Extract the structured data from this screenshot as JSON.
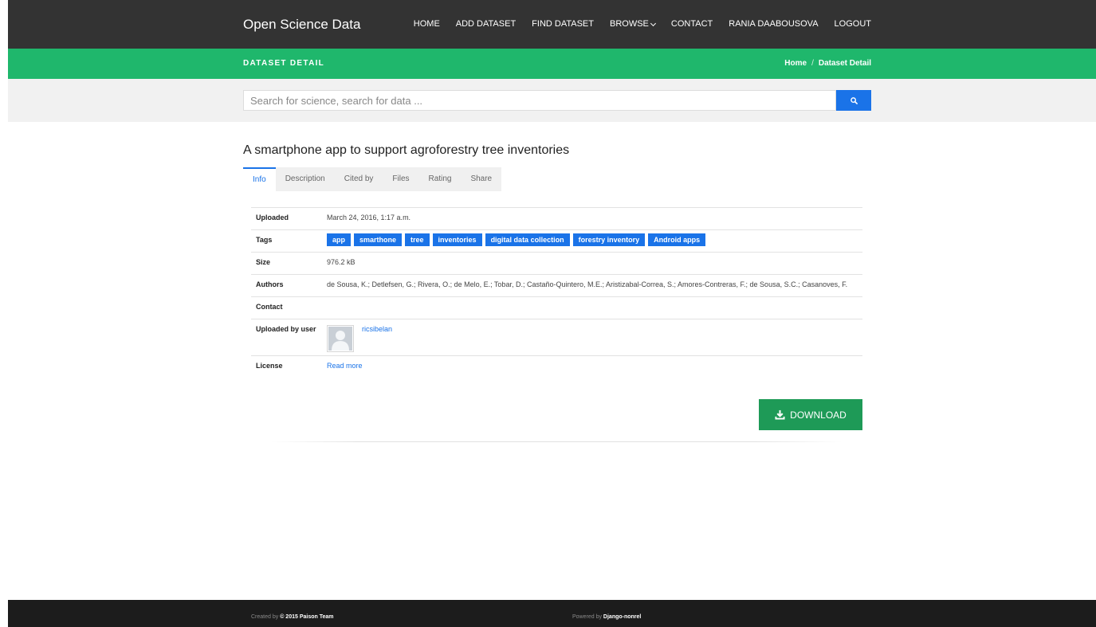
{
  "header": {
    "brand": "Open Science Data",
    "nav": [
      "HOME",
      "ADD DATASET",
      "FIND DATASET",
      "BROWSE",
      "CONTACT",
      "RANIA DAABOUSOVA",
      "LOGOUT"
    ]
  },
  "titlebar": {
    "title": "DATASET DETAIL",
    "breadcrumb": [
      "Home",
      "/",
      "Dataset Detail"
    ]
  },
  "search": {
    "placeholder": "Search for science, search for data ..."
  },
  "dataset": {
    "title": "A smartphone app to support agroforestry tree inventories",
    "tabs": [
      "Info",
      "Description",
      "Cited by",
      "Files",
      "Rating",
      "Share"
    ],
    "rows": {
      "uploaded_label": "Uploaded",
      "uploaded_value": "March 24, 2016, 1:17 a.m.",
      "tags_label": "Tags",
      "tags": [
        "app",
        "smarthone",
        "tree",
        "inventories",
        "digital data collection",
        "forestry inventory",
        "Android apps"
      ],
      "size_label": "Size",
      "size_value": "976.2 kB",
      "authors_label": "Authors",
      "authors_value": "de Sousa, K.; Detlefsen, G.; Rivera, O.; de Melo, E.; Tobar, D.; Castaño-Quintero, M.E.; Aristizabal-Correa, S.; Amores-Contreras, F.; de Sousa, S.C.; Casanoves, F.",
      "contact_label": "Contact",
      "uploader_label": "Uploaded by user",
      "uploader_name": "ricsibelan",
      "license_label": "License",
      "license_link": "Read more"
    },
    "download_label": "DOWNLOAD"
  },
  "footer": {
    "created_prefix": "Created by",
    "created_bold": "© 2015 Paison Team",
    "powered_prefix": "Powered by",
    "powered_bold": "Django-nonrel"
  },
  "colors": {
    "nav_bg": "#333333",
    "green_bar": "#1fb76c",
    "accent_blue": "#1a73e8",
    "download_green": "#1e9a57",
    "footer_bg": "#1c1c1c"
  },
  "icons": [
    "search-icon",
    "chevron-down-icon",
    "download-icon",
    "user-avatar-icon"
  ]
}
